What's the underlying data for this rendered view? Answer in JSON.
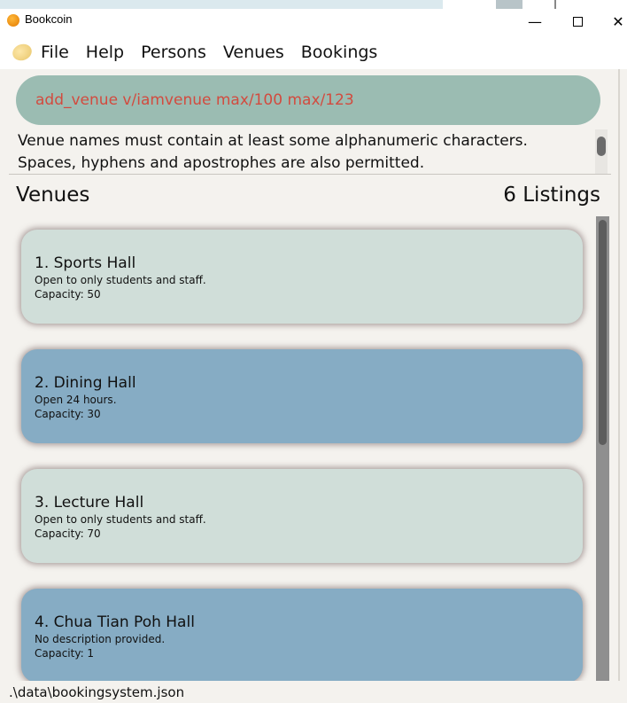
{
  "window": {
    "title": "Bookcoin",
    "controls": {
      "minimize": "—",
      "close": "✕"
    }
  },
  "menu": {
    "items": [
      "File",
      "Help",
      "Persons",
      "Venues",
      "Bookings"
    ]
  },
  "command": {
    "value": "add_venue v/iamvenue max/100 max/123"
  },
  "result": {
    "message": "Venue names must contain at least some alphanumeric characters. Spaces, hyphens and apostrophes are also permitted."
  },
  "list": {
    "title": "Venues",
    "count": "6 Listings",
    "venues": [
      {
        "title": "1.  Sports Hall",
        "description": "Open to only students and staff.",
        "capacity": "Capacity: 50"
      },
      {
        "title": "2.  Dining Hall",
        "description": "Open 24 hours.",
        "capacity": "Capacity: 30"
      },
      {
        "title": "3.  Lecture Hall",
        "description": "Open to only students and staff.",
        "capacity": "Capacity: 70"
      },
      {
        "title": "4.  Chua Tian Poh Hall",
        "description": "No description provided.",
        "capacity": "Capacity: 1"
      }
    ]
  },
  "status": {
    "path": ".\\data\\bookingsystem.json"
  },
  "colors": {
    "command_bg": "#9bbcb2",
    "command_text": "#d24b3f",
    "card_light": "#d0ded9",
    "card_blue": "#86acc4"
  }
}
